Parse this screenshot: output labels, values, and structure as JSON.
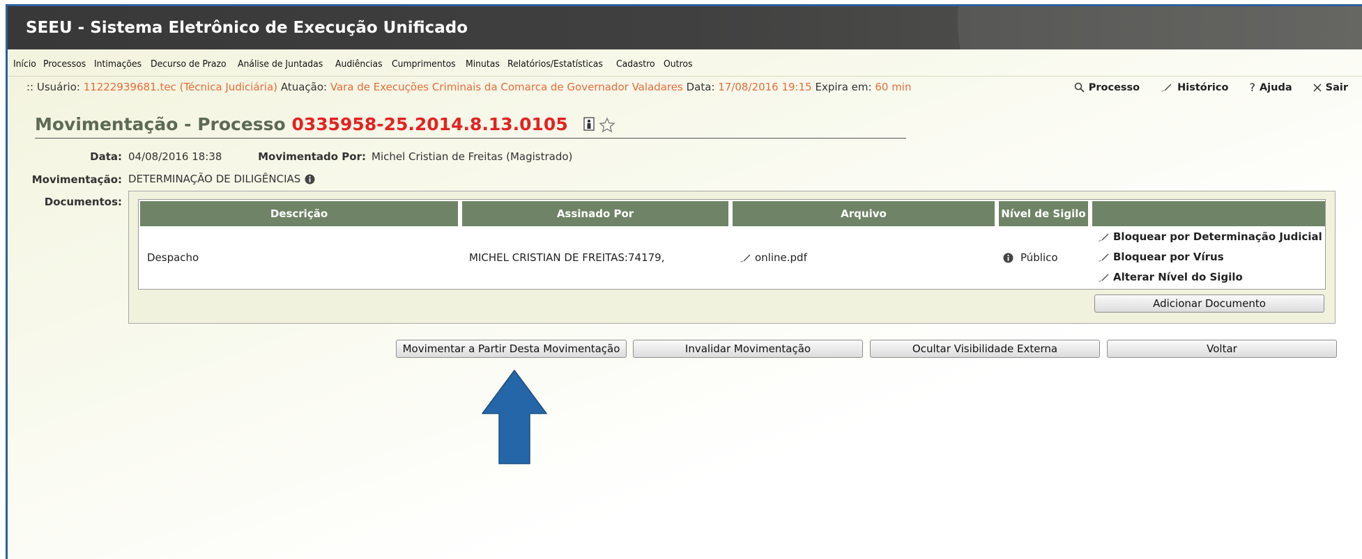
{
  "app": {
    "title": "SEEU - Sistema Eletrônico de Execução Unificado"
  },
  "menu": [
    "Início",
    "Processos",
    "Intimações",
    "Decurso de Prazo",
    "Análise de Juntadas",
    "Audiências",
    "Cumprimentos",
    "Minutas",
    "Relatórios/Estatísticas",
    "Cadastro",
    "Outros"
  ],
  "userbar": {
    "user_label": ":: Usuário:",
    "user_value": "11222939681.tec (Técnica Judiciária)",
    "atuacao_label": "Atuação:",
    "atuacao_value": "Vara de Execuções Criminais da Comarca de Governador Valadares",
    "data_label": "Data:",
    "data_value": "17/08/2016 19:15",
    "expira_label": "Expira em:",
    "expira_value": "60 min"
  },
  "toplinks": {
    "processo": "Processo",
    "historico": "Histórico",
    "ajuda": "Ajuda",
    "sair": "Sair"
  },
  "page": {
    "title_prefix": "Movimentação - Processo",
    "process_number": "0335958-25.2014.8.13.0105"
  },
  "details": {
    "data_label": "Data:",
    "data_value": "04/08/2016 18:38",
    "movimentado_label": "Movimentado Por:",
    "movimentado_value": "Michel Cristian de Freitas (Magistrado)",
    "movimentacao_label": "Movimentação:",
    "movimentacao_value": "DETERMINAÇÃO DE DILIGÊNCIAS",
    "documentos_label": "Documentos:"
  },
  "documents": {
    "headers": [
      "Descrição",
      "Assinado Por",
      "Arquivo",
      "Nível de Sigilo",
      ""
    ],
    "rows": [
      {
        "descricao": "Despacho",
        "assinado_por": "MICHEL CRISTIAN DE FREITAS:74179,",
        "arquivo": "online.pdf",
        "sigilo": "Público",
        "actions": [
          "Bloquear por Determinação Judicial",
          "Bloquear por Vírus",
          "Alterar Nível do Sigilo"
        ]
      }
    ],
    "add_button": "Adicionar Documento"
  },
  "buttons": {
    "movimentar": "Movimentar a Partir Desta Movimentação",
    "invalidar": "Invalidar Movimentação",
    "ocultar": "Ocultar Visibilidade Externa",
    "voltar": "Voltar"
  },
  "colors": {
    "accent_orange": "#e46d3b",
    "process_red": "#e32222",
    "header_green": "#6f8466",
    "annotation_arrow": "#2466a8"
  }
}
